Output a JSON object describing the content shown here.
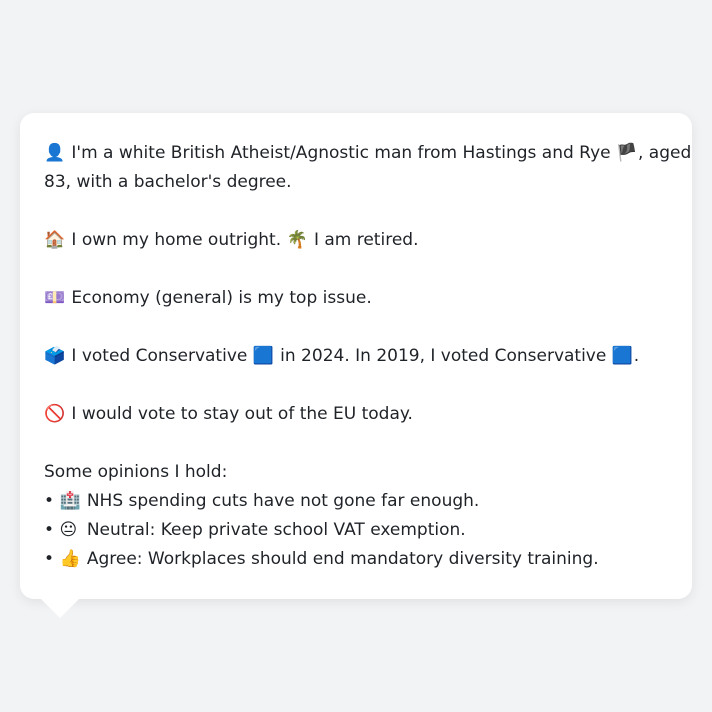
{
  "profile": {
    "identity": {
      "icon": "👤",
      "line1": "I'm a white British Atheist/Agnostic man from Hastings and Rye",
      "flag": "🏴",
      "line1_end": ", aged",
      "line2": "83, with a bachelor's degree."
    },
    "home": {
      "icon_home": "🏠",
      "home_text": "I own my home outright.",
      "icon_palm": "🌴",
      "retired_text": "I am retired."
    },
    "issue": {
      "icon": "💷",
      "text": "Economy (general) is my top issue."
    },
    "vote": {
      "icon": "🗳️",
      "text_a": "I voted Conservative",
      "party_icon_a": "🟦",
      "text_b": "in 2024. In 2019, I voted Conservative",
      "party_icon_b": "🟦",
      "text_end": "."
    },
    "eu": {
      "icon": "🚫",
      "text": "I would vote to stay out of the EU today."
    },
    "opinions": {
      "heading": "Some opinions I hold:",
      "bullet": "•",
      "items": [
        {
          "icon": "🏥",
          "text": "NHS spending cuts have not gone far enough."
        },
        {
          "icon": "😐",
          "text": "Neutral: Keep private school VAT exemption."
        },
        {
          "icon": "👍",
          "text": "Agree: Workplaces should end mandatory diversity training."
        }
      ]
    }
  }
}
